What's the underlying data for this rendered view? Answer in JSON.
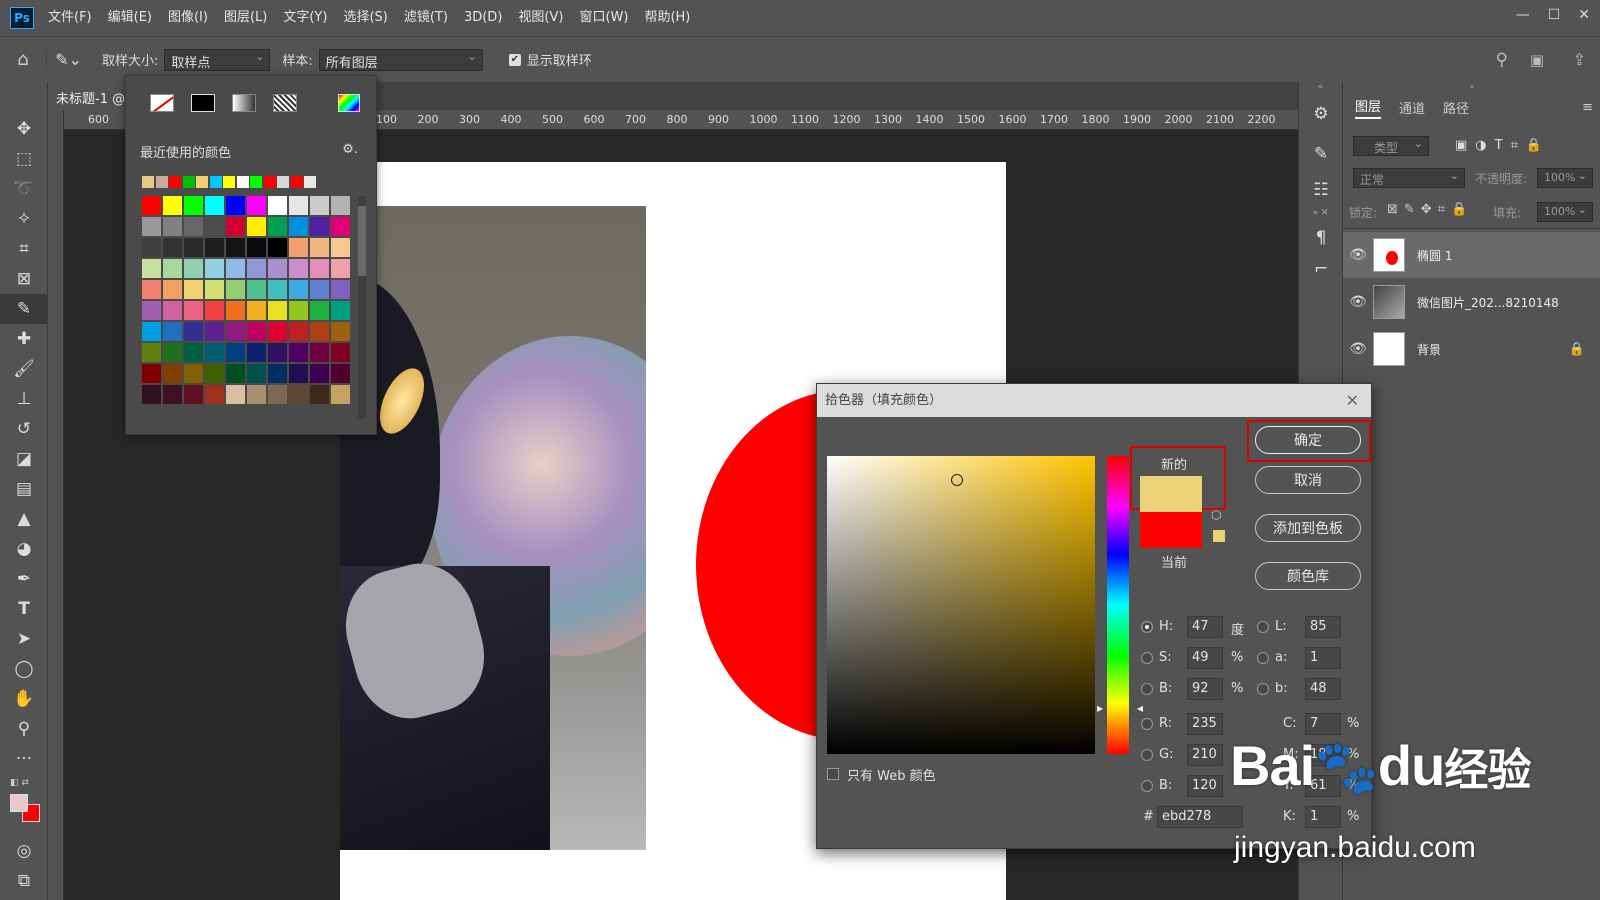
{
  "app": {
    "logo": "Ps",
    "controls": [
      "—",
      "☐",
      "✕"
    ]
  },
  "menu": [
    "文件(F)",
    "编辑(E)",
    "图像(I)",
    "图层(L)",
    "文字(Y)",
    "选择(S)",
    "滤镜(T)",
    "3D(D)",
    "视图(V)",
    "窗口(W)",
    "帮助(H)"
  ],
  "options": {
    "sample_size_label": "取样大小:",
    "sample_size_value": "取样点",
    "sample_label": "样本:",
    "sample_value": "所有图层",
    "show_ring_label": "显示取样环"
  },
  "document": {
    "tab_title": "未标题-1 @"
  },
  "ruler": {
    "h_ticks": [
      "600",
      "100",
      "200",
      "300",
      "400",
      "500",
      "600",
      "700",
      "800",
      "900",
      "1000",
      "1100",
      "1200",
      "1300",
      "1400",
      "1500",
      "1600",
      "1700",
      "1800",
      "1900",
      "2000",
      "2100",
      "2200"
    ]
  },
  "swatches": {
    "title": "最近使用的颜色",
    "recent": [
      "#e9c883",
      "#c8a8a0",
      "#ff0000",
      "#00c000",
      "#f0d070",
      "#00c8ff",
      "#ffff00",
      "#ffffff",
      "#00ff00",
      "#ff0000",
      "#d8d8d8",
      "#ff0000",
      "#e8e8e8"
    ],
    "grid": [
      [
        "#ff0000",
        "#ffff00",
        "#00ff00",
        "#00ffff",
        "#0000ff",
        "#ff00ff",
        "#ffffff",
        "#e6e6e6",
        "#cccccc",
        "#b3b3b3"
      ],
      [
        "#999999",
        "#808080",
        "#666666",
        "#4d4d4d",
        "#d00030",
        "#ffee00",
        "#00a050",
        "#0090e0",
        "#5020a0",
        "#e0007a"
      ],
      [
        "#404040",
        "#333333",
        "#2a2a2a",
        "#1f1f1f",
        "#141414",
        "#0a0a0a",
        "#000000",
        "#f2a070",
        "#f0b880",
        "#f4c890"
      ],
      [
        "#c8e0a0",
        "#a8d8a0",
        "#90d0b0",
        "#90d0e0",
        "#90b8e8",
        "#9098d8",
        "#a890d0",
        "#c890c8",
        "#e090b8",
        "#f0a0a8"
      ],
      [
        "#f08070",
        "#f0a060",
        "#f0d070",
        "#d0e070",
        "#90d070",
        "#50c090",
        "#40c0c0",
        "#40a8e0",
        "#6080d0",
        "#8060c0"
      ],
      [
        "#a060b0",
        "#d060a0",
        "#f06080",
        "#f04040",
        "#f07020",
        "#f0b020",
        "#e8e020",
        "#90c820",
        "#20b040",
        "#00a080"
      ],
      [
        "#00a0e0",
        "#2070c0",
        "#303090",
        "#602090",
        "#901880",
        "#c00060",
        "#e00030",
        "#c02020",
        "#b04010",
        "#a06010"
      ],
      [
        "#608010",
        "#207020",
        "#006040",
        "#006070",
        "#004080",
        "#102070",
        "#301060",
        "#500060",
        "#700040",
        "#800020"
      ],
      [
        "#800000",
        "#804000",
        "#806000",
        "#406000",
        "#005020",
        "#005050",
        "#003060",
        "#201050",
        "#400050",
        "#500030"
      ],
      [
        "#301020",
        "#401020",
        "#601020",
        "#a03020",
        "#d8c0a0",
        "#a89070",
        "#806850",
        "#604830",
        "#402818",
        "#c8a060"
      ]
    ]
  },
  "picker": {
    "title": "拾色器（填充颜色）",
    "new_label": "新的",
    "current_label": "当前",
    "new_color": "#ebd278",
    "current_color": "#ff0000",
    "web_only_label": "只有 Web 颜色",
    "buttons": {
      "ok": "确定",
      "cancel": "取消",
      "add": "添加到色板",
      "library": "颜色库"
    },
    "hsb": {
      "H": "47",
      "S": "49",
      "B": "92",
      "H_unit": "度",
      "S_unit": "%",
      "B_unit": "%"
    },
    "lab": {
      "L": "85",
      "a": "1",
      "b": "48"
    },
    "rgb": {
      "R": "235",
      "G": "210",
      "B": "120"
    },
    "cmyk": {
      "C": "7",
      "M": "18",
      "Y": "61",
      "K": "1",
      "C_unit": "%",
      "M_unit": "%",
      "Y_unit": "%",
      "K_unit": "%"
    },
    "hex": "ebd278"
  },
  "layers_panel": {
    "tabs": [
      "图层",
      "通道",
      "路径"
    ],
    "filter_placeholder": "类型",
    "blend_mode": "正常",
    "opacity_label": "不透明度:",
    "opacity_value": "100%",
    "lock_label": "锁定:",
    "fill_label": "填充:",
    "fill_value": "100%",
    "layers": [
      {
        "name": "椭圆 1",
        "selected": true
      },
      {
        "name": "微信图片_202...8210148",
        "selected": false
      },
      {
        "name": "背景",
        "selected": false
      }
    ]
  },
  "watermark": {
    "brand": "Bai",
    "brand2": "du",
    "brand3": "经验",
    "url": "jingyan.baidu.com"
  }
}
